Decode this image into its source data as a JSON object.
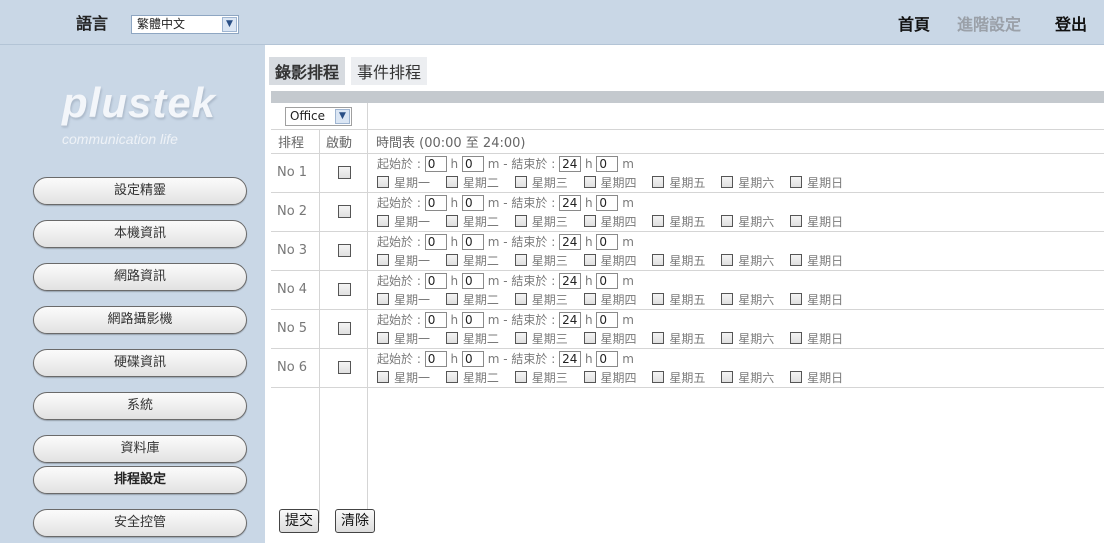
{
  "topbar": {
    "language_label": "語言",
    "language_value": "繁體中文",
    "links": {
      "home": "首頁",
      "advanced": "進階設定",
      "logout": "登出"
    }
  },
  "sidebar": {
    "logo": {
      "main": "plustek",
      "sub": "communication life"
    },
    "items": [
      {
        "label": "設定精靈"
      },
      {
        "label": "本機資訊"
      },
      {
        "label": "網路資訊"
      },
      {
        "label": "網路攝影機"
      },
      {
        "label": "硬碟資訊"
      },
      {
        "label": "系統"
      },
      {
        "label": "資料庫"
      },
      {
        "label": "排程設定",
        "active": true
      },
      {
        "label": "安全控管"
      }
    ]
  },
  "main": {
    "tabs": [
      {
        "label": "錄影排程",
        "active": true
      },
      {
        "label": "事件排程",
        "active": false
      }
    ],
    "profile_select": "Office",
    "headers": {
      "schedule": "排程",
      "enable": "啟動",
      "timetable": "時間表 (00:00 至 24:00)"
    },
    "labels": {
      "start": "起始於 :",
      "end": "m - 結束於 :",
      "h": "h",
      "m": "m",
      "days": [
        "星期一",
        "星期二",
        "星期三",
        "星期四",
        "星期五",
        "星期六",
        "星期日"
      ]
    },
    "rows": [
      {
        "no": "No 1",
        "start_h": "0",
        "start_m": "0",
        "end_h": "24",
        "end_m": "0"
      },
      {
        "no": "No 2",
        "start_h": "0",
        "start_m": "0",
        "end_h": "24",
        "end_m": "0"
      },
      {
        "no": "No 3",
        "start_h": "0",
        "start_m": "0",
        "end_h": "24",
        "end_m": "0"
      },
      {
        "no": "No 4",
        "start_h": "0",
        "start_m": "0",
        "end_h": "24",
        "end_m": "0"
      },
      {
        "no": "No 5",
        "start_h": "0",
        "start_m": "0",
        "end_h": "24",
        "end_m": "0"
      },
      {
        "no": "No 6",
        "start_h": "0",
        "start_m": "0",
        "end_h": "24",
        "end_m": "0"
      }
    ],
    "buttons": {
      "submit": "提交",
      "clear": "清除"
    }
  }
}
